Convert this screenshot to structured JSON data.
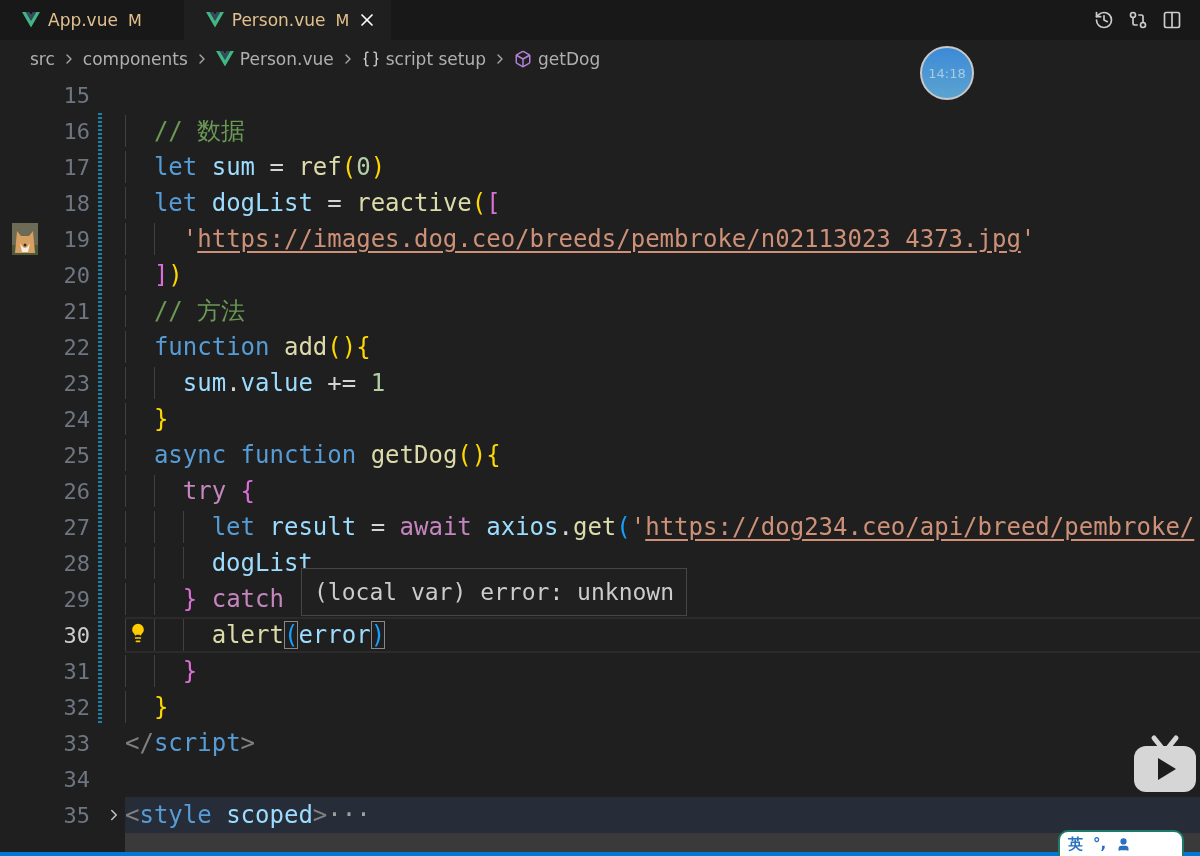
{
  "tabs": [
    {
      "label": "App.vue",
      "status": "M",
      "selected": false
    },
    {
      "label": "Person.vue",
      "status": "M",
      "selected": true
    }
  ],
  "breadcrumbs": [
    {
      "label": "src",
      "kind": "folder"
    },
    {
      "label": "components",
      "kind": "folder"
    },
    {
      "label": "Person.vue",
      "kind": "file"
    },
    {
      "label": "script setup",
      "kind": "block"
    },
    {
      "label": "getDog",
      "kind": "method"
    }
  ],
  "clock": "14:18",
  "lines": [
    {
      "number": "15",
      "modified": false
    },
    {
      "number": "16",
      "modified": true,
      "tokens": [
        {
          "kind": "comment",
          "t": "  // 数据"
        }
      ]
    },
    {
      "number": "17",
      "modified": true,
      "tokens": [
        {
          "kind": "kw",
          "t": "  let"
        },
        {
          "kind": "var",
          "t": " sum"
        },
        {
          "kind": "op",
          "t": " = "
        },
        {
          "kind": "fn",
          "t": "ref"
        },
        {
          "kind": "b1",
          "t": "("
        },
        {
          "kind": "num",
          "t": "0"
        },
        {
          "kind": "b1",
          "t": ")"
        }
      ]
    },
    {
      "number": "18",
      "modified": true,
      "tokens": [
        {
          "kind": "kw",
          "t": "  let"
        },
        {
          "kind": "var",
          "t": " dogList"
        },
        {
          "kind": "op",
          "t": " = "
        },
        {
          "kind": "fn",
          "t": "reactive"
        },
        {
          "kind": "b1",
          "t": "("
        },
        {
          "kind": "b2",
          "t": "["
        }
      ]
    },
    {
      "number": "19",
      "modified": true,
      "kind": "picture",
      "tokens": [
        {
          "kind": "str",
          "t": "    '"
        },
        {
          "kind": "link",
          "t": "https://images.dog.ceo/breeds/pembroke/n02113023_4373.jpg"
        },
        {
          "kind": "str",
          "t": "'"
        }
      ]
    },
    {
      "number": "20",
      "modified": true,
      "tokens": [
        {
          "kind": "b2",
          "t": "  ]"
        },
        {
          "kind": "b1",
          "t": ")"
        }
      ]
    },
    {
      "number": "21",
      "modified": true,
      "tokens": [
        {
          "kind": "comment",
          "t": "  // 方法"
        }
      ]
    },
    {
      "number": "22",
      "modified": true,
      "tokens": [
        {
          "kind": "kw",
          "t": "  function"
        },
        {
          "kind": "fn",
          "t": " add"
        },
        {
          "kind": "b1",
          "t": "()"
        },
        {
          "kind": "b1",
          "t": "{"
        }
      ]
    },
    {
      "number": "23",
      "modified": true,
      "tokens": [
        {
          "kind": "var",
          "t": "    sum"
        },
        {
          "kind": "op",
          "t": "."
        },
        {
          "kind": "var",
          "t": "value"
        },
        {
          "kind": "op",
          "t": " += "
        },
        {
          "kind": "num",
          "t": "1"
        }
      ]
    },
    {
      "number": "24",
      "modified": true,
      "tokens": [
        {
          "kind": "b1",
          "t": "  }"
        }
      ]
    },
    {
      "number": "25",
      "modified": true,
      "tokens": [
        {
          "kind": "kw",
          "t": "  async"
        },
        {
          "kind": "kw",
          "t": " function"
        },
        {
          "kind": "fn",
          "t": " getDog"
        },
        {
          "kind": "b1",
          "t": "()"
        },
        {
          "kind": "b1",
          "t": "{"
        }
      ]
    },
    {
      "number": "26",
      "modified": true,
      "tokens": [
        {
          "kind": "ctrl",
          "t": "    try"
        },
        {
          "kind": "b2",
          "t": " {"
        }
      ]
    },
    {
      "number": "27",
      "modified": true,
      "tokens": [
        {
          "kind": "kw",
          "t": "      let"
        },
        {
          "kind": "var",
          "t": " result"
        },
        {
          "kind": "op",
          "t": " = "
        },
        {
          "kind": "ctrl",
          "t": "await"
        },
        {
          "kind": "var",
          "t": " axios"
        },
        {
          "kind": "op",
          "t": "."
        },
        {
          "kind": "fn",
          "t": "get"
        },
        {
          "kind": "b3",
          "t": "("
        },
        {
          "kind": "str",
          "t": "'"
        },
        {
          "kind": "link",
          "t": "https://dog234.ceo/api/breed/pembroke/"
        }
      ]
    },
    {
      "number": "28",
      "modified": true,
      "tokens": [
        {
          "kind": "var",
          "t": "      dogList"
        }
      ]
    },
    {
      "number": "29",
      "modified": true,
      "tokens": [
        {
          "kind": "b2",
          "t": "    }"
        },
        {
          "kind": "ctrl",
          "t": " catch"
        }
      ]
    },
    {
      "number": "30",
      "modified": true,
      "current": true,
      "kind": "lightbulb",
      "tokens": [
        {
          "kind": "fn",
          "t": "      alert"
        },
        {
          "kind": "match",
          "t": "("
        },
        {
          "kind": "var",
          "t": "error"
        },
        {
          "kind": "match",
          "t": ")"
        }
      ]
    },
    {
      "number": "31",
      "modified": true,
      "tokens": [
        {
          "kind": "b2",
          "t": "    }"
        }
      ]
    },
    {
      "number": "32",
      "modified": true,
      "tokens": [
        {
          "kind": "b1",
          "t": "  }"
        }
      ]
    },
    {
      "number": "33",
      "modified": false,
      "tokens": [
        {
          "kind": "tagp",
          "t": "</"
        },
        {
          "kind": "tag",
          "t": "script"
        },
        {
          "kind": "tagp",
          "t": ">"
        }
      ]
    },
    {
      "number": "34",
      "modified": false
    },
    {
      "number": "35",
      "modified": false,
      "expanded": false,
      "tokens": [
        {
          "kind": "tagp",
          "t": "<"
        },
        {
          "kind": "tag",
          "t": "style"
        },
        {
          "kind": "attr",
          "t": " scoped"
        },
        {
          "kind": "tagp",
          "t": ">"
        },
        {
          "kind": "ellipsis",
          "t": "···"
        }
      ]
    },
    {
      "highlighted": true
    }
  ],
  "hover": {
    "text": "(local var) error: unknown"
  },
  "ime": {
    "label": "英",
    "symbols": "°,"
  }
}
